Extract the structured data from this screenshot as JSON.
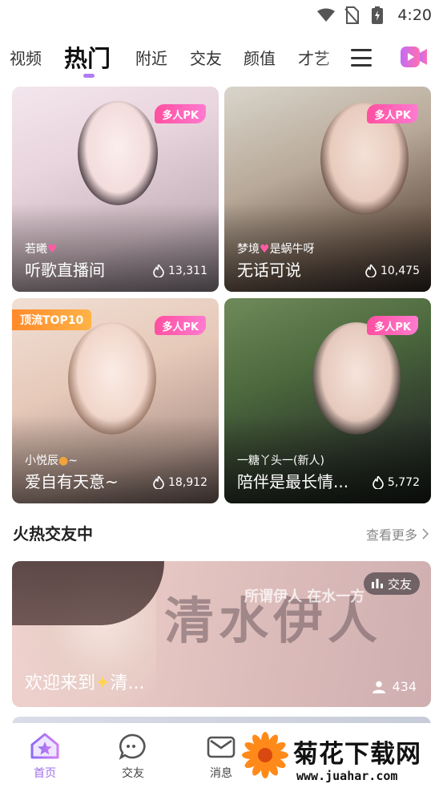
{
  "status_bar": {
    "time": "4:20"
  },
  "top_tabs": {
    "items": [
      "视频",
      "热门",
      "附近",
      "交友",
      "颜值",
      "才艺"
    ],
    "active": "热门"
  },
  "live_cards": [
    {
      "user": "若曦",
      "title": "听歌直播间",
      "views": "13,311",
      "badge": "多人PK",
      "tag": ""
    },
    {
      "user": "梦境",
      "user_suffix": "是蜗牛呀",
      "title": "无话可说",
      "views": "10,475",
      "badge": "多人PK",
      "tag": ""
    },
    {
      "user": "小悦辰",
      "user_suffix": "~",
      "title": "爱自有天意~",
      "views": "18,912",
      "badge": "多人PK",
      "tag": "顶流TOP10"
    },
    {
      "user": "一糖丫头一(新人)",
      "title": "陪伴是最长情...",
      "views": "5,772",
      "badge": "多人PK",
      "tag": ""
    }
  ],
  "section": {
    "title": "火热交友中",
    "more": "查看更多"
  },
  "banner": {
    "calligraphy": "清水伊人",
    "subtitle": "所谓伊人 在水一方",
    "tag": "交友",
    "title": "欢迎来到",
    "title_suffix": "清...",
    "count": "434"
  },
  "bottom_nav": {
    "items": [
      "首页",
      "交友",
      "消息"
    ],
    "active": "首页"
  },
  "watermark": {
    "text": "菊花下载网",
    "url": "www.juahar.com"
  },
  "colors": {
    "accent": "#a06cf0",
    "pk_badge": "#ff4fa0",
    "top_badge": "#ff8a2a"
  }
}
